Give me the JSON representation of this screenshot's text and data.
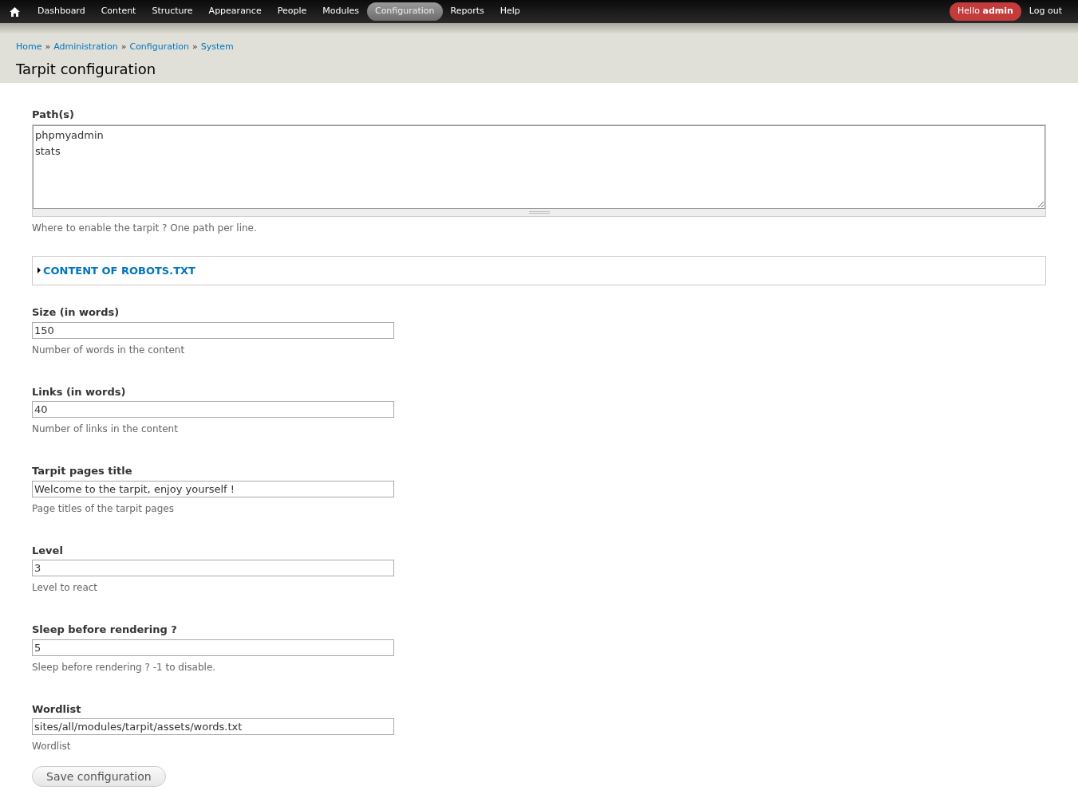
{
  "toolbar": {
    "menu": [
      {
        "label": "Dashboard",
        "selected": false
      },
      {
        "label": "Content",
        "selected": false
      },
      {
        "label": "Structure",
        "selected": false
      },
      {
        "label": "Appearance",
        "selected": false
      },
      {
        "label": "People",
        "selected": false
      },
      {
        "label": "Modules",
        "selected": false
      },
      {
        "label": "Configuration",
        "selected": true
      },
      {
        "label": "Reports",
        "selected": false
      },
      {
        "label": "Help",
        "selected": false
      }
    ],
    "greeting": "Hello **admin**",
    "logout": "Log out"
  },
  "breadcrumb": [
    "Home",
    "Administration",
    "Configuration",
    "System"
  ],
  "breadcrumb_separator": "»",
  "page_title": "Tarpit configuration",
  "paths": {
    "label": "Path(s)",
    "value": "phpmyadmin\nstats",
    "description": "Where to enable the tarpit ? One path per line."
  },
  "robots_fieldset": {
    "legend": "CONTENT OF ROBOTS.TXT",
    "expanded": false
  },
  "fields": [
    {
      "label": "Size (in words)",
      "value": "150",
      "description": "Number of words in the content"
    },
    {
      "label": "Links (in words)",
      "value": "40",
      "description": "Number of links in the content"
    },
    {
      "label": "Tarpit pages title",
      "value": "Welcome to the tarpit, enjoy yourself !",
      "description": "Page titles of the tarpit pages"
    },
    {
      "label": "Level",
      "value": "3",
      "description": "Level to react"
    },
    {
      "label": "Sleep before rendering ?",
      "value": "5",
      "description": "Sleep before rendering ? -1 to disable."
    },
    {
      "label": "Wordlist",
      "value": "sites/all/modules/tarpit/assets/words.txt",
      "description": "Wordlist"
    }
  ],
  "save_button": "Save configuration"
}
